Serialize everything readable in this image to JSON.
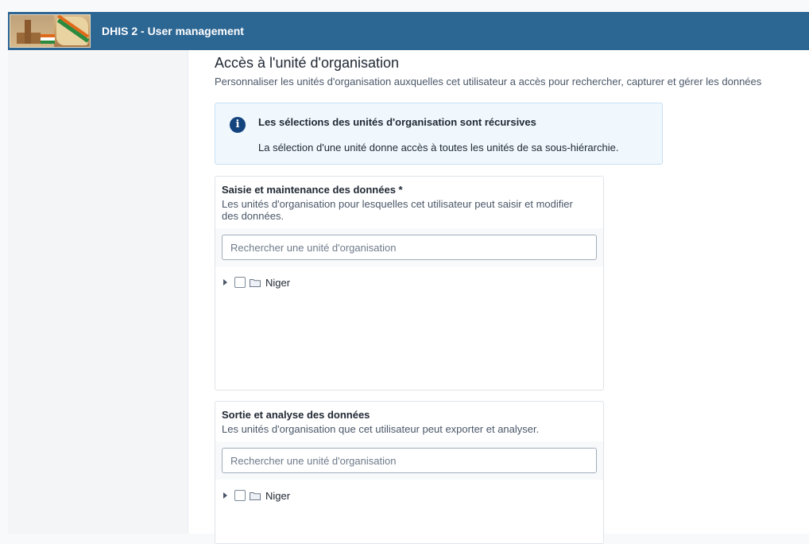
{
  "header": {
    "app_title": "DHIS 2 - User management"
  },
  "section": {
    "title": "Accès à l'unité d'organisation",
    "description": "Personnaliser les unités d'organisation auxquelles cet utilisateur a accès pour rechercher, capturer et gérer les données"
  },
  "notice": {
    "icon": "info-icon",
    "title": "Les sélections des unités d'organisation sont récursives",
    "text": "La sélection d'une unité donne accès à toutes les unités de sa sous-hiérarchie."
  },
  "cards": [
    {
      "title": "Saisie et maintenance des données *",
      "description": "Les unités d'organisation pour lesquelles cet utilisateur peut saisir et modifier des données.",
      "search_placeholder": "Rechercher une unité d'organisation",
      "tree_root": "Niger"
    },
    {
      "title": "Sortie et analyse des données",
      "description": "Les unités d'organisation que cet utilisateur peut exporter et analyser.",
      "search_placeholder": "Rechercher une unité d'organisation",
      "tree_root": "Niger"
    }
  ],
  "colors": {
    "header_bg": "#2c6693",
    "info_icon": "#14447d",
    "notice_bg": "#f0f8fe"
  }
}
